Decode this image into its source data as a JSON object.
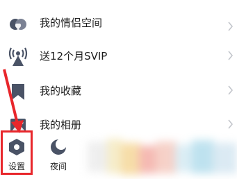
{
  "menu": {
    "items": [
      {
        "label": "我的情侣空间",
        "icon": "heart-icon"
      },
      {
        "label": "送12个月SVIP",
        "icon": "broadcast-tower-icon"
      },
      {
        "label": "我的收藏",
        "icon": "bookmark-icon"
      },
      {
        "label": "我的相册",
        "icon": "photo-album-icon"
      }
    ]
  },
  "bottom": {
    "settings_label": "设置",
    "night_label": "夜间"
  },
  "colors": {
    "icon": "#4a5366",
    "highlight": "#e8262b",
    "chevron": "#c3c6cc"
  }
}
